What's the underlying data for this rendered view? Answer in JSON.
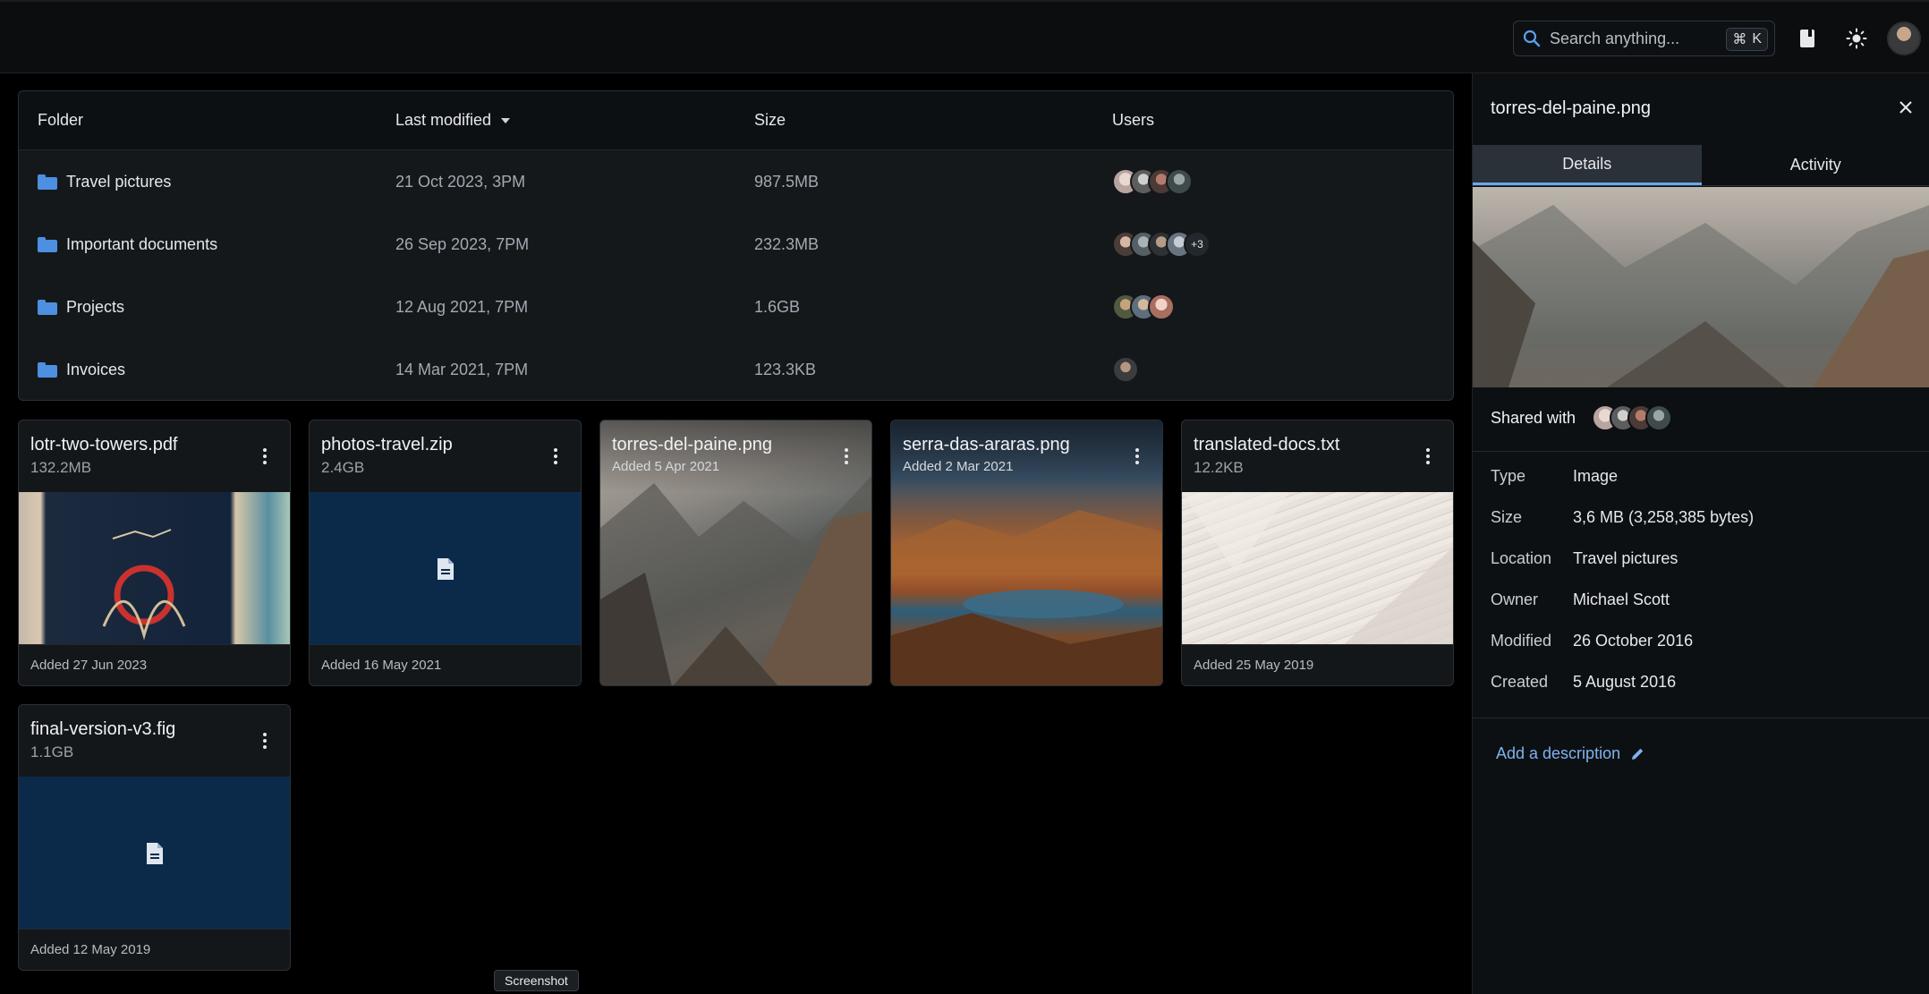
{
  "header": {
    "search": {
      "placeholder": "Search anything...",
      "shortcut_symbol": "⌘",
      "shortcut_key": "K"
    },
    "icons": [
      "search-icon",
      "book-icon",
      "sun-icon",
      "user-avatar"
    ]
  },
  "table": {
    "headers": {
      "folder": "Folder",
      "last_modified": "Last modified",
      "size": "Size",
      "users": "Users"
    },
    "sort": {
      "column": "Last modified",
      "direction": "desc"
    },
    "rows": [
      {
        "name": "Travel pictures",
        "modified": "21 Oct 2023, 3PM",
        "size": "987.5MB",
        "user_count": 4,
        "extra": ""
      },
      {
        "name": "Important documents",
        "modified": "26 Sep 2023, 7PM",
        "size": "232.3MB",
        "user_count": 4,
        "extra": "+3"
      },
      {
        "name": "Projects",
        "modified": "12 Aug 2021, 7PM",
        "size": "1.6GB",
        "user_count": 3,
        "extra": ""
      },
      {
        "name": "Invoices",
        "modified": "14 Mar 2021, 7PM",
        "size": "123.3KB",
        "user_count": 1,
        "extra": ""
      }
    ]
  },
  "cards": [
    {
      "title": "lotr-two-towers.pdf",
      "sub": "132.2MB",
      "footer": "Added 27 Jun 2023",
      "thumb": "book-cover-image"
    },
    {
      "title": "photos-travel.zip",
      "sub": "2.4GB",
      "footer": "Added 16 May 2021",
      "thumb": "file-icon"
    },
    {
      "title": "torres-del-paine.png",
      "sub": "Added 5 Apr 2021",
      "footer": "",
      "thumb": "mountain-image"
    },
    {
      "title": "serra-das-araras.png",
      "sub": "Added 2 Mar 2021",
      "footer": "",
      "thumb": "landscape-image"
    },
    {
      "title": "translated-docs.txt",
      "sub": "12.2KB",
      "footer": "Added 25 May 2019",
      "thumb": "papers-image"
    },
    {
      "title": "final-version-v3.fig",
      "sub": "1.1GB",
      "footer": "Added 12 May 2019",
      "thumb": "file-icon"
    }
  ],
  "panel": {
    "title": "torres-del-paine.png",
    "tabs": [
      "Details",
      "Activity"
    ],
    "active_tab": "Details",
    "shared_with_label": "Shared with",
    "properties": [
      {
        "key": "Type",
        "value": "Image"
      },
      {
        "key": "Size",
        "value": "3,6 MB (3,258,385 bytes)"
      },
      {
        "key": "Location",
        "value": "Travel pictures"
      },
      {
        "key": "Owner",
        "value": "Michael Scott"
      },
      {
        "key": "Modified",
        "value": "26 October 2016"
      },
      {
        "key": "Created",
        "value": "5 August 2016"
      }
    ],
    "add_description": "Add a description"
  },
  "tooltip": "Screenshot",
  "colors": {
    "accent": "#6aa7ec",
    "folder": "#4d8fe0",
    "doc_thumb_bg": "#0b2a4a"
  }
}
